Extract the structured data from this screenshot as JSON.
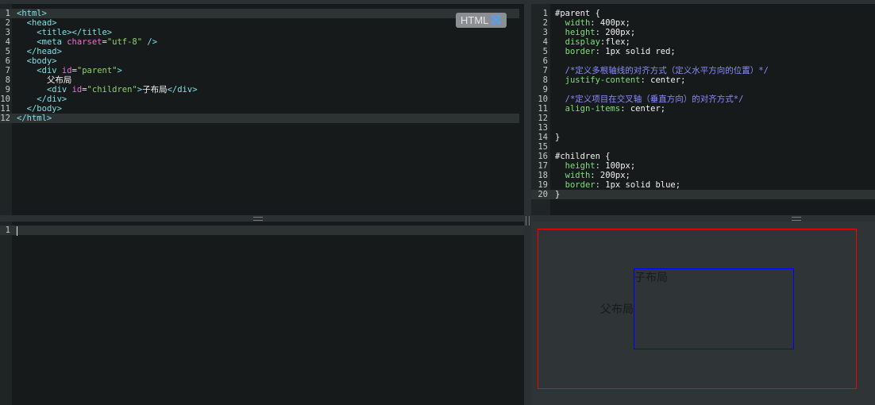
{
  "html_panel": {
    "badge_label": "HTML",
    "lines": [
      {
        "n": "1",
        "html": "<span class=\"tag\">&lt;html&gt;</span>"
      },
      {
        "n": "2",
        "html": "  <span class=\"tag\">&lt;head&gt;</span>"
      },
      {
        "n": "3",
        "html": "    <span class=\"tag\">&lt;title&gt;&lt;/title&gt;</span>"
      },
      {
        "n": "4",
        "html": "    <span class=\"tag\">&lt;meta</span> <span class=\"attr\">charset</span>=<span class=\"str\">\"utf-8\"</span> <span class=\"tag\">/&gt;</span>"
      },
      {
        "n": "5",
        "html": "  <span class=\"tag\">&lt;/head&gt;</span>"
      },
      {
        "n": "6",
        "html": "  <span class=\"tag\">&lt;body&gt;</span>"
      },
      {
        "n": "7",
        "html": "    <span class=\"tag\">&lt;div</span> <span class=\"attr\">id</span>=<span class=\"str\">\"parent\"</span><span class=\"tag\">&gt;</span>"
      },
      {
        "n": "8",
        "html": "      <span class=\"txt\">父布局</span>"
      },
      {
        "n": "9",
        "html": "      <span class=\"tag\">&lt;div</span> <span class=\"attr\">id</span>=<span class=\"str\">\"children\"</span><span class=\"tag\">&gt;</span><span class=\"txt\">子布局</span><span class=\"tag\">&lt;/div&gt;</span>"
      },
      {
        "n": "10",
        "html": "    <span class=\"tag\">&lt;/div&gt;</span>"
      },
      {
        "n": "11",
        "html": "  <span class=\"tag\">&lt;/body&gt;</span>"
      },
      {
        "n": "12",
        "html": "<span class=\"tag\">&lt;/html&gt;</span>"
      }
    ]
  },
  "css_panel": {
    "lines": [
      {
        "n": "1",
        "html": "<span class=\"sel\">#parent {</span>"
      },
      {
        "n": "2",
        "html": "  <span class=\"prop\">width</span>: <span class=\"val\">400px;</span>"
      },
      {
        "n": "3",
        "html": "  <span class=\"prop\">height</span>: <span class=\"val\">200px;</span>"
      },
      {
        "n": "4",
        "html": "  <span class=\"prop\">display</span>:<span class=\"val\">flex;</span>"
      },
      {
        "n": "5",
        "html": "  <span class=\"prop\">border</span>: <span class=\"val\">1px solid red;</span>"
      },
      {
        "n": "6",
        "html": ""
      },
      {
        "n": "7",
        "html": "  <span class=\"cmt\">/*定义多根轴线的对齐方式（定义水平方向的位置）*/</span>"
      },
      {
        "n": "8",
        "html": "  <span class=\"prop\">justify-content</span>: <span class=\"val\">center;</span>"
      },
      {
        "n": "9",
        "html": ""
      },
      {
        "n": "10",
        "html": "  <span class=\"cmt\">/*定义项目在交叉轴（垂直方向）的对齐方式*/</span>"
      },
      {
        "n": "11",
        "html": "  <span class=\"prop\">align-items</span>: <span class=\"val\">center;</span>"
      },
      {
        "n": "12",
        "html": ""
      },
      {
        "n": "13",
        "html": ""
      },
      {
        "n": "14",
        "html": "<span class=\"sel\">}</span>"
      },
      {
        "n": "15",
        "html": ""
      },
      {
        "n": "16",
        "html": "<span class=\"sel\">#children {</span>"
      },
      {
        "n": "17",
        "html": "  <span class=\"prop\">height</span>: <span class=\"val\">100px;</span>"
      },
      {
        "n": "18",
        "html": "  <span class=\"prop\">width</span>: <span class=\"val\">200px;</span>"
      },
      {
        "n": "19",
        "html": "  <span class=\"prop\">border</span>: <span class=\"val\">1px solid blue;</span>"
      },
      {
        "n": "20",
        "html": "<span class=\"sel\">}</span>"
      }
    ]
  },
  "js_panel": {
    "lines": [
      {
        "n": "1",
        "html": ""
      }
    ]
  },
  "preview": {
    "parent_text": "父布局",
    "children_text": "子布局"
  }
}
